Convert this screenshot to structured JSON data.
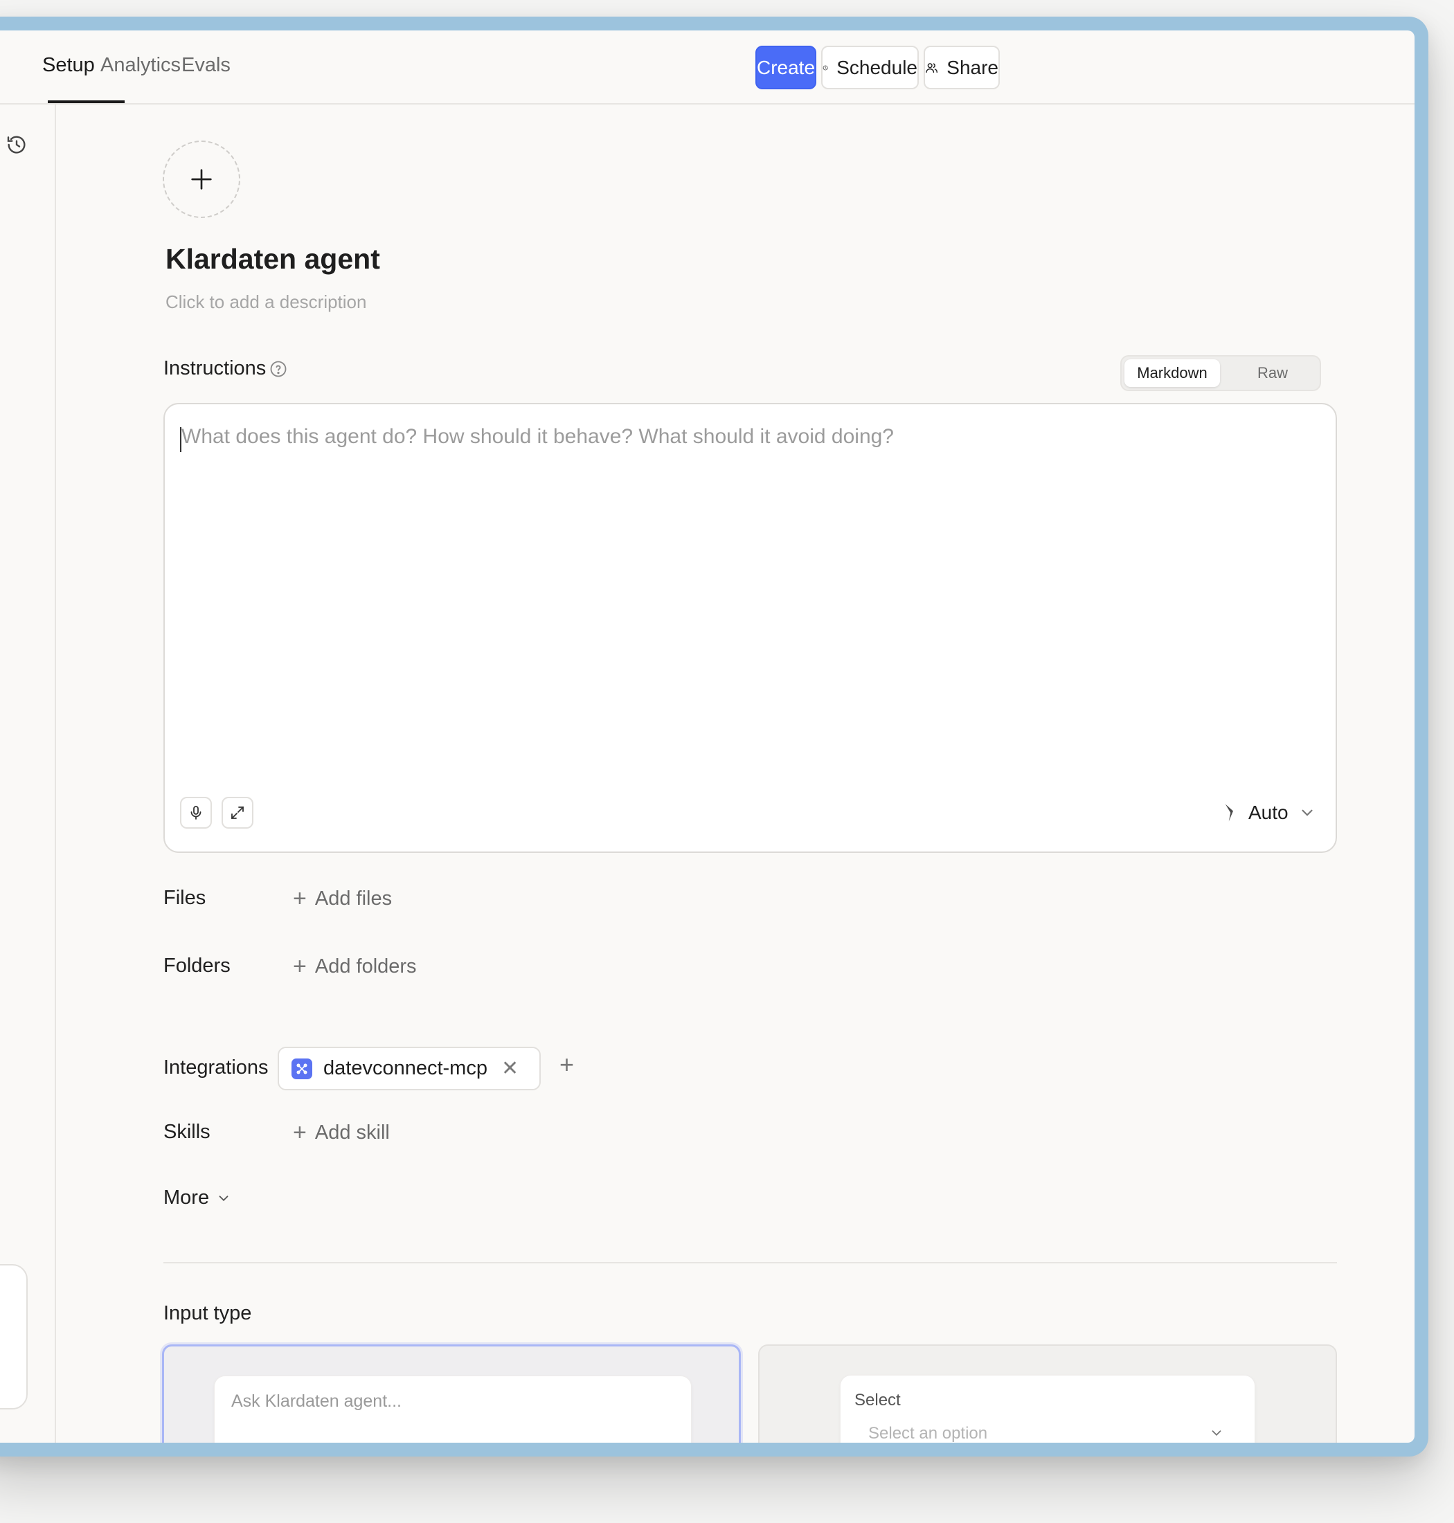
{
  "tabs": [
    {
      "label": "Setup",
      "active": true
    },
    {
      "label": "Analytics",
      "active": false
    },
    {
      "label": "Evals",
      "active": false
    }
  ],
  "header_buttons": {
    "create": "Create",
    "schedule": "Schedule",
    "share": "Share"
  },
  "agent": {
    "name": "Klardaten agent",
    "description_placeholder": "Click to add a description"
  },
  "instructions": {
    "label": "Instructions",
    "mode_options": [
      "Markdown",
      "Raw"
    ],
    "active_mode": "Markdown",
    "placeholder": "What does this agent do? How should it behave? What should it avoid doing?",
    "model_selector": "Auto"
  },
  "resources": {
    "files_label": "Files",
    "files_action": "Add files",
    "folders_label": "Folders",
    "folders_action": "Add folders",
    "integrations_label": "Integrations",
    "integrations": [
      {
        "name": "datevconnect-mcp"
      }
    ],
    "skills_label": "Skills",
    "skills_action": "Add skill",
    "more_label": "More"
  },
  "input_type": {
    "label": "Input type",
    "chat_placeholder": "Ask Klardaten agent...",
    "select_label": "Select",
    "select_placeholder": "Select an option"
  },
  "colors": {
    "primary": "#4a6cf7",
    "frame": "#9cc3dd",
    "background": "#faf9f7"
  }
}
